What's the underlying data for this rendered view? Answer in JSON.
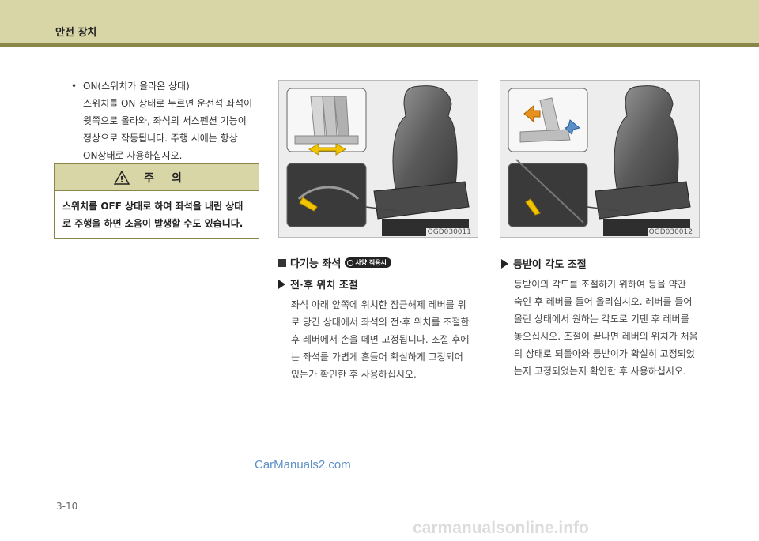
{
  "header": {
    "title": "안전 장치"
  },
  "left_column": {
    "bullet_mark": "•",
    "bullet_heading": "ON(스위치가 올라온 상태)",
    "bullet_lines": [
      "스위치를 ON 상태로 누르면 운전석 좌석이",
      "윗쪽으로 올라와, 좌석의 서스펜션 기능이",
      "정상으로 작동됩니다. 주행 시에는 항상",
      "ON상태로 사용하십시오."
    ]
  },
  "caution": {
    "icon_glyph": "!",
    "title": "주의",
    "lines": [
      "스위치를 OFF 상태로 하여 좌석을 내린 상태",
      "로 주행을 하면 소음이 발생할 수도 있습니다."
    ]
  },
  "figures": [
    {
      "code": "OGD030011"
    },
    {
      "code": "OGD030012"
    }
  ],
  "section": {
    "title": "다기능 좌석",
    "badge": "사양 적용시"
  },
  "fore_aft": {
    "title": "전·후 위치 조절",
    "lines": [
      "좌석 아래 앞쪽에 위치한 잠금해제 레버를 위",
      "로 당긴 상태에서 좌석의 전·후 위치를 조절한",
      "후 레버에서 손을 떼면 고정됩니다. 조절 후에",
      "는 좌석를 가볍게 흔들어 확실하게 고정되어",
      "있는가 확인한 후 사용하십시오."
    ]
  },
  "backrest": {
    "title": "등받이 각도 조절",
    "lines": [
      "등받이의 각도를 조절하기 위하여 등을 약간",
      "숙인 후 레버를 들어 올리십시오. 레버를 들어",
      "올린 상태에서 원하는 각도로 기댄 후 레버를",
      "놓으십시오. 조절이 끝나면 레버의 위치가 처음",
      "의 상태로 되돌아와 등받이가 확실히 고정되었",
      "는지 고정되었는지 확인한 후 사용하십시오."
    ]
  },
  "footer": {
    "page_number": "3-10",
    "watermark_site": "CarManuals2.com",
    "watermark_bottom": "carmanualsonline.info"
  },
  "colors": {
    "header_band": "#d8d5a6",
    "header_rule": "#8a8548",
    "arrow_yellow": "#f2c400",
    "arrow_orange": "#e8901c"
  }
}
